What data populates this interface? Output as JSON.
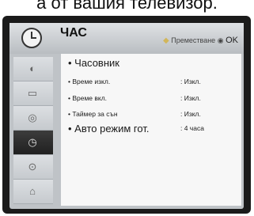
{
  "caption": "а от вашия телевизор.",
  "header": {
    "title": "ЧАС",
    "hint_nav_icon": "◆",
    "hint_text": "Преместване",
    "hint_ok_icon": "◉",
    "hint_ok": "OK"
  },
  "sidebar": {
    "items": [
      {
        "name": "picture-icon",
        "glyph": "◐",
        "active": false
      },
      {
        "name": "screen-icon",
        "glyph": "▭",
        "active": false
      },
      {
        "name": "disc-icon",
        "glyph": "◎",
        "active": false
      },
      {
        "name": "clock-icon",
        "glyph": "◷",
        "active": true
      },
      {
        "name": "lock-icon",
        "glyph": "⊙",
        "active": false
      },
      {
        "name": "toolbox-icon",
        "glyph": "⌂",
        "active": false
      }
    ]
  },
  "menu": {
    "items": [
      {
        "label": "• Часовник",
        "value": ""
      },
      {
        "label": "• Време изкл.",
        "value": ": Изкл."
      },
      {
        "label": "• Време вкл.",
        "value": ": Изкл."
      },
      {
        "label": "• Таймер за сън",
        "value": ": Изкл."
      },
      {
        "label": "• Авто режим гот.",
        "value": ": 4 часа"
      }
    ]
  },
  "colors": {
    "frame": "#1b1b1b",
    "panel": "#bfc3c7",
    "content": "#f7f7f7",
    "active_tab": "#2e2e2e"
  }
}
